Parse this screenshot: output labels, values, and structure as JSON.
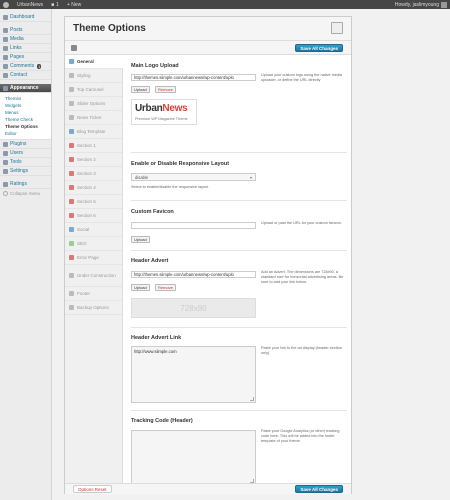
{
  "adminbar": {
    "site_name": "UrbanNews",
    "comments_count": "1",
    "new_label": "+ New",
    "howdy": "Howdy, jaslimyoung"
  },
  "sidebar": {
    "items": [
      {
        "label": "Dashboard"
      },
      {
        "label": "Posts"
      },
      {
        "label": "Media"
      },
      {
        "label": "Links"
      },
      {
        "label": "Pages"
      },
      {
        "label": "Comments",
        "badge": "1"
      },
      {
        "label": "Contact"
      },
      {
        "label": "Appearance"
      }
    ],
    "appearance_sub": [
      "Themes",
      "Widgets",
      "Menus",
      "Theme Check",
      "Theme Options",
      "Editor"
    ],
    "items_after": [
      {
        "label": "Plugins"
      },
      {
        "label": "Users"
      },
      {
        "label": "Tools"
      },
      {
        "label": "Settings"
      },
      {
        "label": "Ratings"
      }
    ],
    "collapse_label": "Collapse menu"
  },
  "panel": {
    "title": "Theme Options",
    "save_label": "Save All Changes",
    "reset_label": "Options Reset"
  },
  "tabs": [
    {
      "label": "General",
      "icon": "gear-icon"
    },
    {
      "label": "Styling",
      "icon": "brush-icon"
    },
    {
      "label": "Top Carousel",
      "icon": "carousel-icon"
    },
    {
      "label": "Slider Options",
      "icon": "slider-icon"
    },
    {
      "label": "News Ticker",
      "icon": "ticker-icon"
    },
    {
      "label": "Blog Template",
      "icon": "blog-icon"
    },
    {
      "label": "Section 1",
      "icon": "section-icon"
    },
    {
      "label": "Section 2",
      "icon": "section-icon"
    },
    {
      "label": "Section 3",
      "icon": "section-icon"
    },
    {
      "label": "Section 4",
      "icon": "section-icon"
    },
    {
      "label": "Section 5",
      "icon": "section-icon"
    },
    {
      "label": "Section 6",
      "icon": "section-icon"
    },
    {
      "label": "Social",
      "icon": "social-icon"
    },
    {
      "label": "SEO",
      "icon": "seo-icon"
    },
    {
      "label": "Error Page",
      "icon": "error-icon"
    },
    {
      "label": "Under Construction",
      "icon": "construction-icon"
    },
    {
      "label": "Footer",
      "icon": "footer-icon"
    },
    {
      "label": "Backup Options",
      "icon": "backup-icon"
    }
  ],
  "content": {
    "logo": {
      "title": "Main Logo Upload",
      "value": "http://themes.siimple.com/urbannews/wp-content/uplo",
      "desc": "Upload your custom logo using the native media uploader, or define the URL directly",
      "upload_label": "Upload",
      "remove_label": "Remove",
      "preview_brand_1": "Urban",
      "preview_brand_2": "News",
      "preview_tagline": "Premium WP Magazine Theme"
    },
    "responsive": {
      "title": "Enable or Disable Responsive Layout",
      "value": "disable",
      "desc": "Select to enable/disable the responsive layout"
    },
    "favicon": {
      "title": "Custom Favicon",
      "value": "",
      "desc": "Upload or past the URL for your custom favicon.",
      "upload_label": "Upload"
    },
    "header_advert": {
      "title": "Header Advert",
      "value": "http://themes.siimple.com/urbannews/wp-content/uplo",
      "desc": "Add an Advert. The dimensions are 728x90, a standard size for horizontal advertising areas. Be sure to add your link below.",
      "upload_label": "Upload",
      "remove_label": "Remove",
      "placeholder_size": "728x90"
    },
    "header_link": {
      "title": "Header Advert Link",
      "value": "http://www.siimple.com",
      "desc": "Paste your link to the ad display (header section only)."
    },
    "tracking": {
      "title": "Tracking Code (Header)",
      "value": "",
      "desc": "Paste your Google Analytics (or other) tracking code here. This will be added into the footer template of your theme."
    }
  }
}
